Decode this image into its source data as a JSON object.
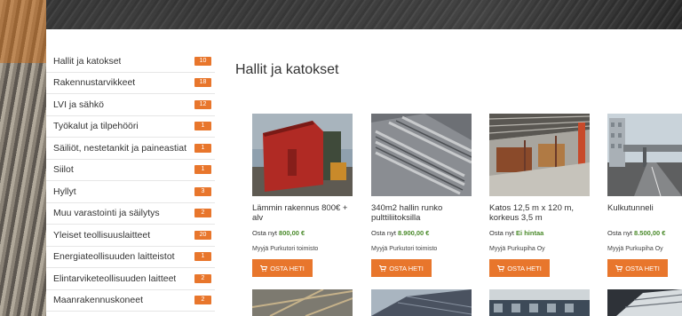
{
  "categories": [
    {
      "label": "Hallit ja katokset",
      "count": "10"
    },
    {
      "label": "Rakennustarvikkeet",
      "count": "18"
    },
    {
      "label": "LVI ja sähkö",
      "count": "12"
    },
    {
      "label": "Työkalut ja tilpehööri",
      "count": "1"
    },
    {
      "label": "Säiliöt, nestetankit ja paineastiat",
      "count": "1"
    },
    {
      "label": "Siilot",
      "count": "1"
    },
    {
      "label": "Hyllyt",
      "count": "3"
    },
    {
      "label": "Muu varastointi ja säilytys",
      "count": "2"
    },
    {
      "label": "Yleiset teollisuuslaitteet",
      "count": "20"
    },
    {
      "label": "Energiateollisuuden laitteistot",
      "count": "1"
    },
    {
      "label": "Elintarviketeollisuuden laitteet",
      "count": "2"
    },
    {
      "label": "Maanrakennuskoneet",
      "count": "2"
    }
  ],
  "main": {
    "title": "Hallit ja katokset"
  },
  "products": [
    {
      "name": "Lämmin rakennus 800€ + alv",
      "price_prefix": "Osta nyt",
      "price": "800,00 €",
      "seller": "Myyjä Purkutori toimisto",
      "buy_label": "OSTA HETI"
    },
    {
      "name": "340m2 hallin runko pulttiliitoksilla",
      "price_prefix": "Osta nyt",
      "price": "8.900,00 €",
      "seller": "Myyjä Purkutori toimisto",
      "buy_label": "OSTA HETI"
    },
    {
      "name": "Katos 12,5 m x 120 m, korkeus 3,5 m",
      "price_prefix": "Osta nyt",
      "price": "Ei hintaa",
      "seller": "Myyjä Purkupiha Oy",
      "buy_label": "OSTA HETI"
    },
    {
      "name": "Kulkutunneli",
      "price_prefix": "Osta nyt",
      "price": "8.500,00 €",
      "seller": "Myyjä Purkupiha Oy",
      "buy_label": "OSTA HETI"
    }
  ],
  "colors": {
    "accent": "#e8762c",
    "price": "#4a8a2a"
  }
}
